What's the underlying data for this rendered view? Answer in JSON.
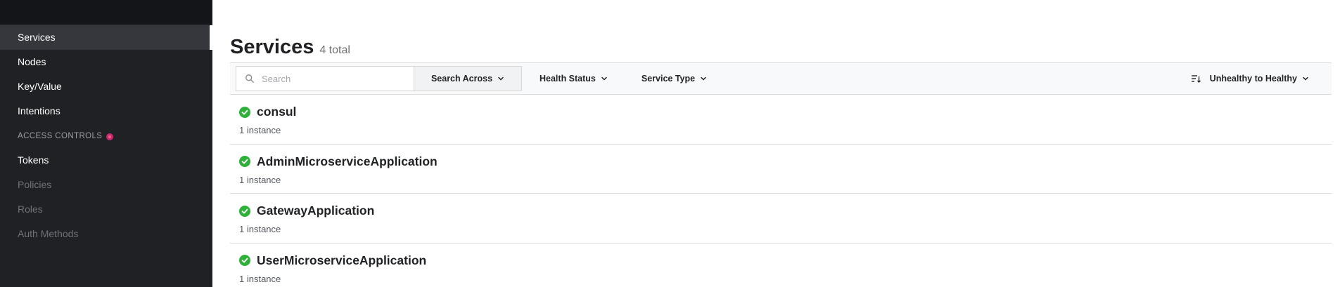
{
  "sidebar": {
    "items": [
      {
        "label": "Services"
      },
      {
        "label": "Nodes"
      },
      {
        "label": "Key/Value"
      },
      {
        "label": "Intentions"
      }
    ],
    "section_label": "ACCESS CONTROLS",
    "acl_items": [
      {
        "label": "Tokens"
      },
      {
        "label": "Policies"
      },
      {
        "label": "Roles"
      },
      {
        "label": "Auth Methods"
      }
    ]
  },
  "page": {
    "title": "Services",
    "count": "4 total"
  },
  "toolbar": {
    "search_placeholder": "Search",
    "search_across_label": "Search Across",
    "health_label": "Health Status",
    "service_type_label": "Service Type",
    "sort_label": "Unhealthy to Healthy"
  },
  "services": [
    {
      "name": "consul",
      "instances": "1 instance"
    },
    {
      "name": "AdminMicroserviceApplication",
      "instances": "1 instance"
    },
    {
      "name": "GatewayApplication",
      "instances": "1 instance"
    },
    {
      "name": "UserMicroserviceApplication",
      "instances": "1 instance"
    }
  ],
  "colors": {
    "sidebar_bg": "#1f2124",
    "healthy_green": "#2eb039",
    "acl_badge": "#c62a71"
  }
}
